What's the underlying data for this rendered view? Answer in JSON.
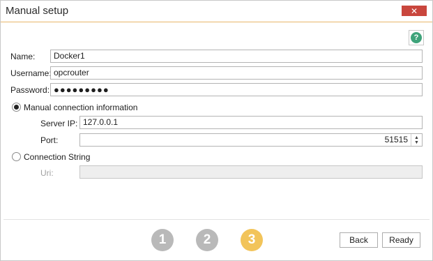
{
  "window": {
    "title": "Manual setup",
    "close_glyph": "✕"
  },
  "help": {
    "glyph": "?",
    "icon": "help-icon"
  },
  "form": {
    "name_label": "Name:",
    "name_value": "Docker1",
    "username_label": "Username:",
    "username_value": "opcrouter",
    "password_label": "Password:",
    "password_value": "●●●●●●●●●"
  },
  "manual": {
    "label": "Manual connection information",
    "selected": true,
    "server_ip_label": "Server IP:",
    "server_ip_value": "127.0.0.1",
    "port_label": "Port:",
    "port_value": "51515",
    "spin_up": "▲",
    "spin_down": "▼"
  },
  "connection_string": {
    "label": "Connection String",
    "selected": false,
    "uri_label": "Uri:",
    "uri_value": ""
  },
  "steps": [
    {
      "label": "1",
      "color": "#b9b9b9"
    },
    {
      "label": "2",
      "color": "#b9b9b9"
    },
    {
      "label": "3",
      "color": "#f2c45a"
    }
  ],
  "buttons": {
    "back": "Back",
    "ready": "Ready"
  },
  "colors": {
    "accent": "#e8b66a",
    "close": "#c9463d",
    "help": "#3ea37a"
  }
}
